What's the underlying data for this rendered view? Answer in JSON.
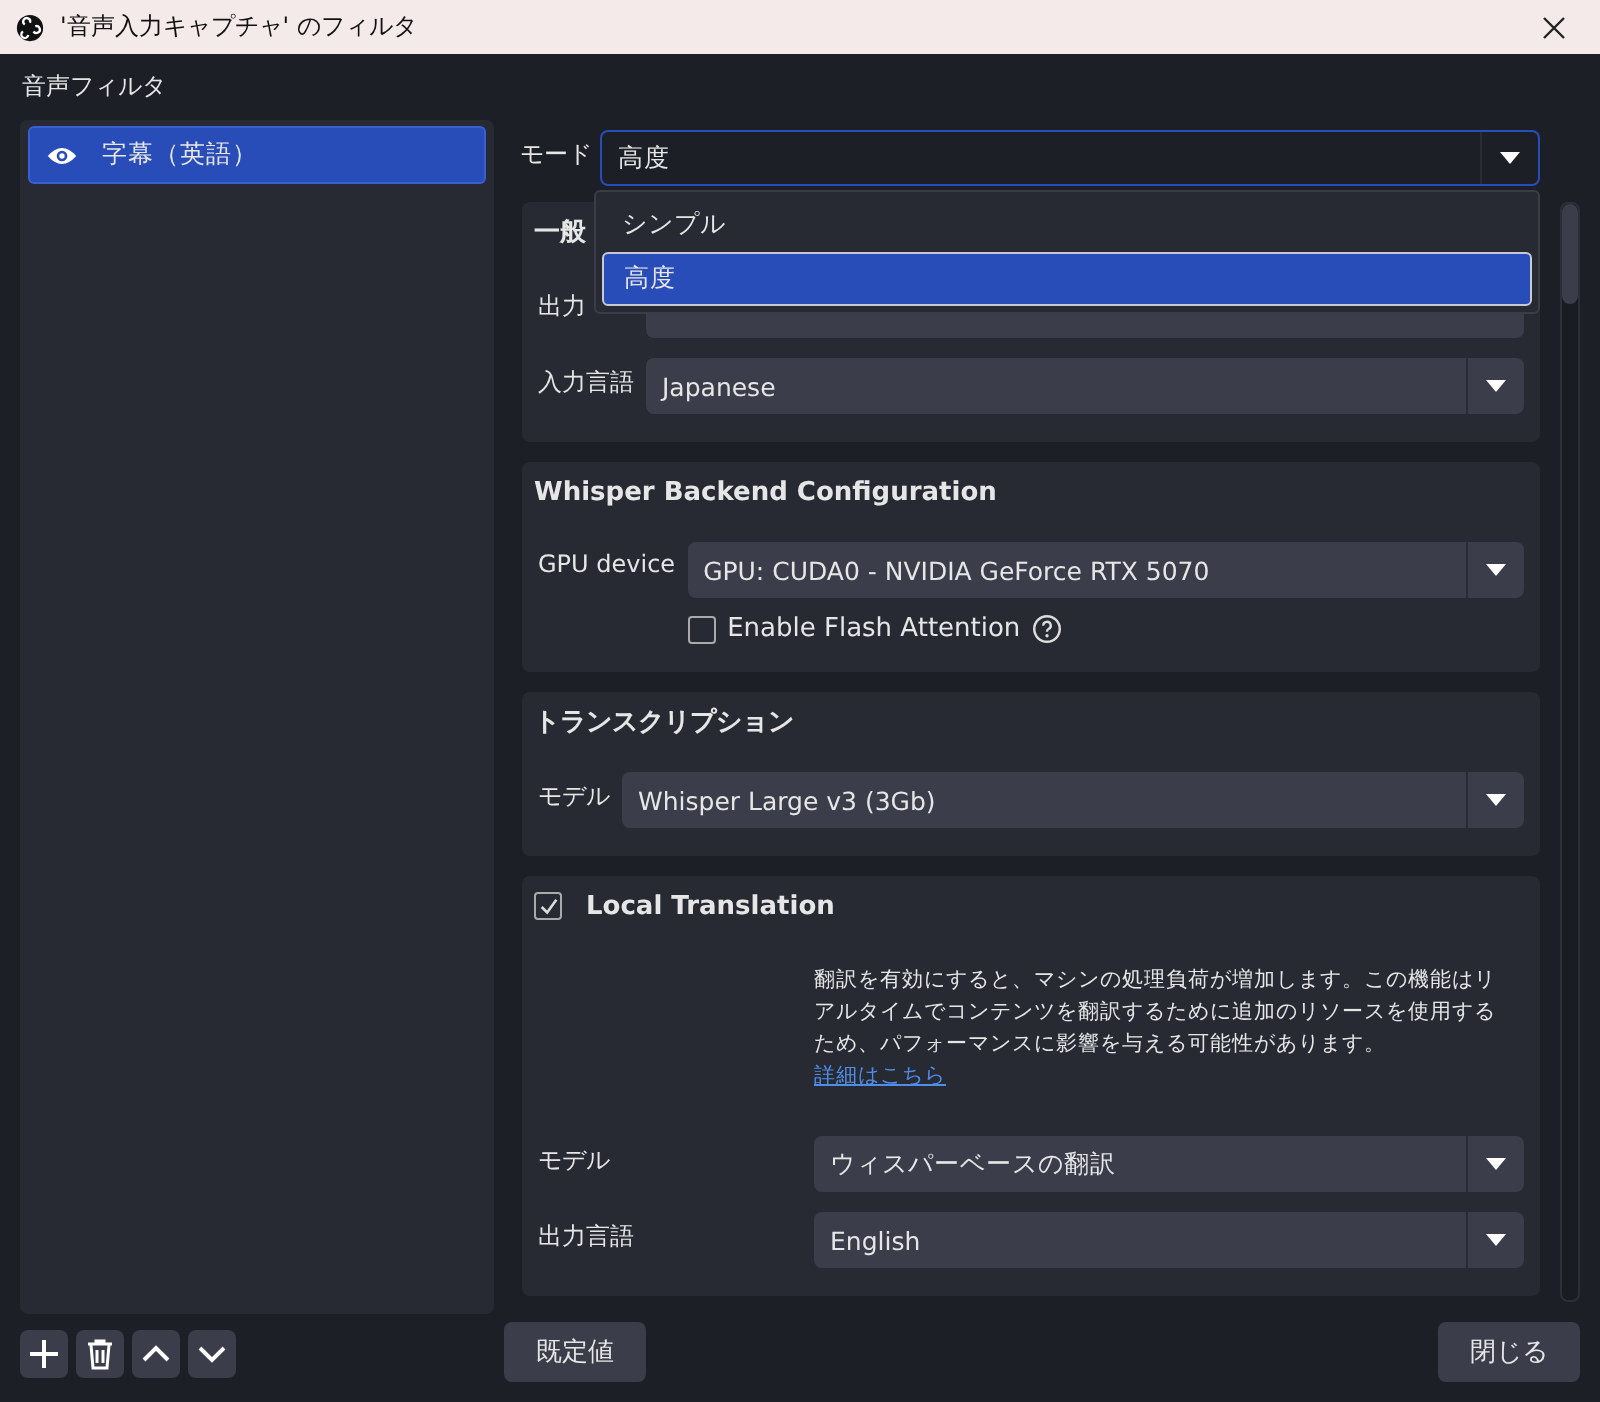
{
  "window": {
    "title": "'音声入力キャプチャ' のフィルタ"
  },
  "filters": {
    "label": "音声フィルタ",
    "items": [
      {
        "name": "字幕（英語）",
        "visible": true,
        "selected": true
      }
    ]
  },
  "mode": {
    "label": "モード",
    "value": "高度",
    "expanded": true,
    "options": [
      {
        "label": "シンプル",
        "selected": false
      },
      {
        "label": "高度",
        "selected": true
      }
    ]
  },
  "sections": [
    {
      "title": "一般",
      "fields": [
        {
          "label": "出力"
        },
        {
          "label": "入力言語",
          "value": "Japanese"
        }
      ]
    },
    {
      "title": "Whisper Backend Configuration",
      "fields": [
        {
          "label": "GPU device",
          "value": "GPU: CUDA0 - NVIDIA GeForce RTX 5070"
        }
      ],
      "option": {
        "label": "Enable Flash Attention",
        "checked": false
      }
    },
    {
      "title": "トランスクリプション",
      "fields": [
        {
          "label": "モデル",
          "value": "Whisper Large v3 (3Gb)"
        }
      ]
    },
    {
      "title": "Local Translation",
      "checked": true,
      "note": "翻訳を有効にすると、マシンの処理負荷が増加します。この機能はリアルタイムでコンテンツを翻訳するために追加のリソースを使用するため、パフォーマンスに影響を与える可能性があります。",
      "link": "詳細はこちら",
      "fields": [
        {
          "label": "モデル",
          "value": "ウィスパーベースの翻訳"
        },
        {
          "label": "出力言語",
          "value": "English"
        }
      ]
    }
  ],
  "buttons": {
    "defaults": "既定値",
    "close": "閉じる"
  }
}
